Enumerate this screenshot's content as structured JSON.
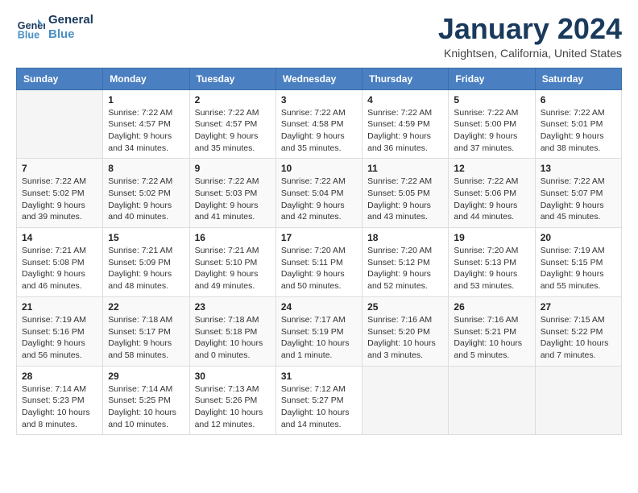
{
  "logo": {
    "text1": "General",
    "text2": "Blue"
  },
  "title": "January 2024",
  "subtitle": "Knightsen, California, United States",
  "headers": [
    "Sunday",
    "Monday",
    "Tuesday",
    "Wednesday",
    "Thursday",
    "Friday",
    "Saturday"
  ],
  "weeks": [
    [
      {
        "num": "",
        "lines": []
      },
      {
        "num": "1",
        "lines": [
          "Sunrise: 7:22 AM",
          "Sunset: 4:57 PM",
          "Daylight: 9 hours",
          "and 34 minutes."
        ]
      },
      {
        "num": "2",
        "lines": [
          "Sunrise: 7:22 AM",
          "Sunset: 4:57 PM",
          "Daylight: 9 hours",
          "and 35 minutes."
        ]
      },
      {
        "num": "3",
        "lines": [
          "Sunrise: 7:22 AM",
          "Sunset: 4:58 PM",
          "Daylight: 9 hours",
          "and 35 minutes."
        ]
      },
      {
        "num": "4",
        "lines": [
          "Sunrise: 7:22 AM",
          "Sunset: 4:59 PM",
          "Daylight: 9 hours",
          "and 36 minutes."
        ]
      },
      {
        "num": "5",
        "lines": [
          "Sunrise: 7:22 AM",
          "Sunset: 5:00 PM",
          "Daylight: 9 hours",
          "and 37 minutes."
        ]
      },
      {
        "num": "6",
        "lines": [
          "Sunrise: 7:22 AM",
          "Sunset: 5:01 PM",
          "Daylight: 9 hours",
          "and 38 minutes."
        ]
      }
    ],
    [
      {
        "num": "7",
        "lines": [
          "Sunrise: 7:22 AM",
          "Sunset: 5:02 PM",
          "Daylight: 9 hours",
          "and 39 minutes."
        ]
      },
      {
        "num": "8",
        "lines": [
          "Sunrise: 7:22 AM",
          "Sunset: 5:02 PM",
          "Daylight: 9 hours",
          "and 40 minutes."
        ]
      },
      {
        "num": "9",
        "lines": [
          "Sunrise: 7:22 AM",
          "Sunset: 5:03 PM",
          "Daylight: 9 hours",
          "and 41 minutes."
        ]
      },
      {
        "num": "10",
        "lines": [
          "Sunrise: 7:22 AM",
          "Sunset: 5:04 PM",
          "Daylight: 9 hours",
          "and 42 minutes."
        ]
      },
      {
        "num": "11",
        "lines": [
          "Sunrise: 7:22 AM",
          "Sunset: 5:05 PM",
          "Daylight: 9 hours",
          "and 43 minutes."
        ]
      },
      {
        "num": "12",
        "lines": [
          "Sunrise: 7:22 AM",
          "Sunset: 5:06 PM",
          "Daylight: 9 hours",
          "and 44 minutes."
        ]
      },
      {
        "num": "13",
        "lines": [
          "Sunrise: 7:22 AM",
          "Sunset: 5:07 PM",
          "Daylight: 9 hours",
          "and 45 minutes."
        ]
      }
    ],
    [
      {
        "num": "14",
        "lines": [
          "Sunrise: 7:21 AM",
          "Sunset: 5:08 PM",
          "Daylight: 9 hours",
          "and 46 minutes."
        ]
      },
      {
        "num": "15",
        "lines": [
          "Sunrise: 7:21 AM",
          "Sunset: 5:09 PM",
          "Daylight: 9 hours",
          "and 48 minutes."
        ]
      },
      {
        "num": "16",
        "lines": [
          "Sunrise: 7:21 AM",
          "Sunset: 5:10 PM",
          "Daylight: 9 hours",
          "and 49 minutes."
        ]
      },
      {
        "num": "17",
        "lines": [
          "Sunrise: 7:20 AM",
          "Sunset: 5:11 PM",
          "Daylight: 9 hours",
          "and 50 minutes."
        ]
      },
      {
        "num": "18",
        "lines": [
          "Sunrise: 7:20 AM",
          "Sunset: 5:12 PM",
          "Daylight: 9 hours",
          "and 52 minutes."
        ]
      },
      {
        "num": "19",
        "lines": [
          "Sunrise: 7:20 AM",
          "Sunset: 5:13 PM",
          "Daylight: 9 hours",
          "and 53 minutes."
        ]
      },
      {
        "num": "20",
        "lines": [
          "Sunrise: 7:19 AM",
          "Sunset: 5:15 PM",
          "Daylight: 9 hours",
          "and 55 minutes."
        ]
      }
    ],
    [
      {
        "num": "21",
        "lines": [
          "Sunrise: 7:19 AM",
          "Sunset: 5:16 PM",
          "Daylight: 9 hours",
          "and 56 minutes."
        ]
      },
      {
        "num": "22",
        "lines": [
          "Sunrise: 7:18 AM",
          "Sunset: 5:17 PM",
          "Daylight: 9 hours",
          "and 58 minutes."
        ]
      },
      {
        "num": "23",
        "lines": [
          "Sunrise: 7:18 AM",
          "Sunset: 5:18 PM",
          "Daylight: 10 hours",
          "and 0 minutes."
        ]
      },
      {
        "num": "24",
        "lines": [
          "Sunrise: 7:17 AM",
          "Sunset: 5:19 PM",
          "Daylight: 10 hours",
          "and 1 minute."
        ]
      },
      {
        "num": "25",
        "lines": [
          "Sunrise: 7:16 AM",
          "Sunset: 5:20 PM",
          "Daylight: 10 hours",
          "and 3 minutes."
        ]
      },
      {
        "num": "26",
        "lines": [
          "Sunrise: 7:16 AM",
          "Sunset: 5:21 PM",
          "Daylight: 10 hours",
          "and 5 minutes."
        ]
      },
      {
        "num": "27",
        "lines": [
          "Sunrise: 7:15 AM",
          "Sunset: 5:22 PM",
          "Daylight: 10 hours",
          "and 7 minutes."
        ]
      }
    ],
    [
      {
        "num": "28",
        "lines": [
          "Sunrise: 7:14 AM",
          "Sunset: 5:23 PM",
          "Daylight: 10 hours",
          "and 8 minutes."
        ]
      },
      {
        "num": "29",
        "lines": [
          "Sunrise: 7:14 AM",
          "Sunset: 5:25 PM",
          "Daylight: 10 hours",
          "and 10 minutes."
        ]
      },
      {
        "num": "30",
        "lines": [
          "Sunrise: 7:13 AM",
          "Sunset: 5:26 PM",
          "Daylight: 10 hours",
          "and 12 minutes."
        ]
      },
      {
        "num": "31",
        "lines": [
          "Sunrise: 7:12 AM",
          "Sunset: 5:27 PM",
          "Daylight: 10 hours",
          "and 14 minutes."
        ]
      },
      {
        "num": "",
        "lines": []
      },
      {
        "num": "",
        "lines": []
      },
      {
        "num": "",
        "lines": []
      }
    ]
  ]
}
